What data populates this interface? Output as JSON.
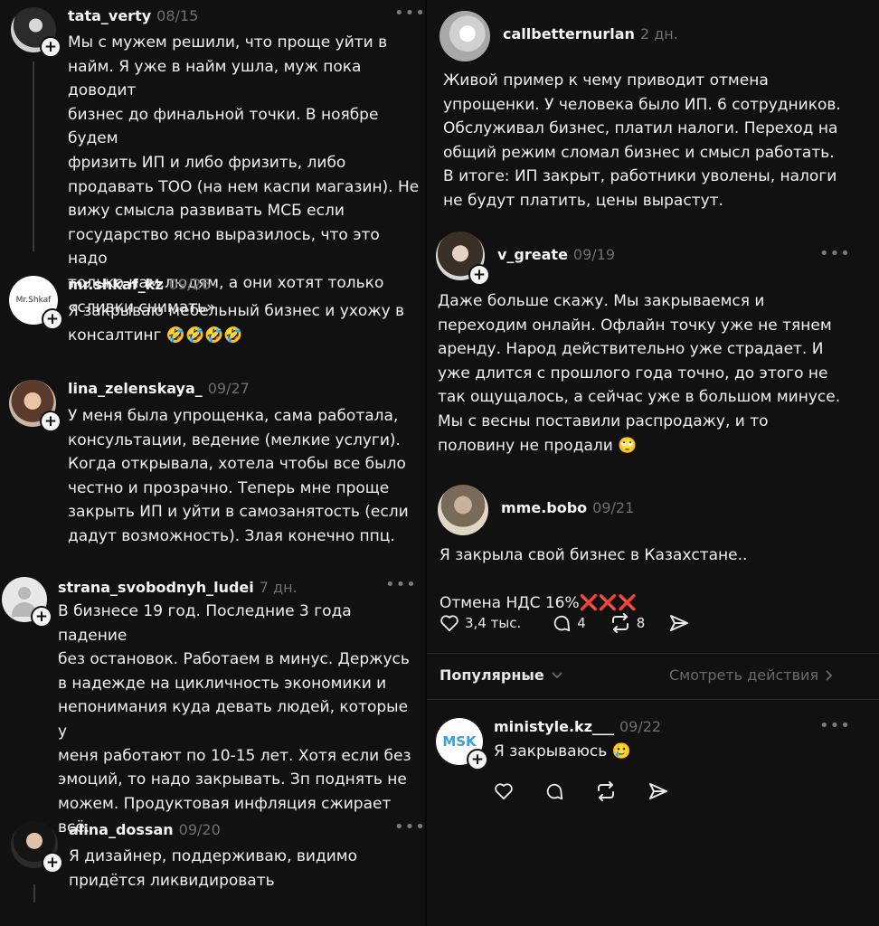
{
  "left": {
    "posts": [
      {
        "username": "tata_verty",
        "date": "08/15",
        "text": "Мы с мужем решили, что проще уйти в\nнайм. Я уже в найм ушла, муж пока доводит\nбизнес до финальной точки. В ноябре будем\nфризить ИП и либо фризить, либо\nпродавать ТОО (на нем каспи магазин). Не\nвижу смысла развивать МСБ если\nгосударство ясно выразилось, что это надо\nтолько нам,людям, а они хотят только\n«сливки снимать»"
      },
      {
        "username": "mr.shkaf_kz",
        "date": "09/26",
        "avatar_text": "Mr.Shkaf",
        "text": "Я закрываю мебельный бизнес и ухожу в\nконсалтинг 🤣🤣🤣🤣"
      },
      {
        "username": "lina_zelenskaya_",
        "date": "09/27",
        "text": "У меня была упрощенка, сама работала,\nконсультации, ведение (мелкие услуги).\nКогда открывала, хотела чтобы все было\nчестно и прозрачно. Теперь мне проще\nзакрыть ИП и уйти в самозанятость (если\nдадут возможность). Злая конечно ппц."
      },
      {
        "username": "strana_svobodnyh_ludei",
        "date": "7 дн.",
        "text": "В бизнесе 19 год. Последние 3 года падение\nбез остановок. Работаем в минус. Держусь\nв надежде на цикличность экономики и\nнепонимания куда девать людей, которые у\nменя работают по 10-15 лет. Хотя если без\nэмоций, то надо закрывать. Зп поднять не\nможем. Продуктовая инфляция сжирает\nвсё."
      },
      {
        "username": "alina_dossan",
        "date": "09/20",
        "text": "Я дизайнер, поддерживаю, видимо\nпридётся ликвидировать"
      }
    ]
  },
  "right": {
    "posts": [
      {
        "username": "callbetternurlan",
        "date": "2 дн.",
        "text": "Живой пример к чему приводит отмена\nупрощенки. У человека было ИП. 6 сотрудников.\nОбслуживал бизнес, платил налоги. Переход на\nобщий режим сломал бизнес и смысл работать.\nВ итоге: ИП закрыт, работники уволены, налоги\nне будут платить, цены вырастут."
      },
      {
        "username": "v_greate",
        "date": "09/19",
        "text": "Даже больше скажу. Мы закрываемся и\nпереходим онлайн. Офлайн точку уже не тянем\nаренду. Народ действительно уже страдает. И\nуже длится с прошлого года точно, до этого не\nтак ощущалось, а сейчас уже в большом минусе.\nМы с весны поставили распродажу, и то\nполовину не продали 🙄"
      },
      {
        "username": "mme.bobo",
        "date": "09/21",
        "text": "Я закрыла свой бизнес в Казахстане..\n\nОтмена НДС 16%❌❌❌",
        "likes": "3,4 тыс.",
        "comments": "4",
        "reposts": "8"
      },
      {
        "username": "ministyle.kz___",
        "date": "09/22",
        "avatar_text": "MSK",
        "text": "Я закрываюсь 🥲"
      }
    ],
    "popular_label": "Популярные",
    "view_actions_label": "Смотреть действия"
  }
}
